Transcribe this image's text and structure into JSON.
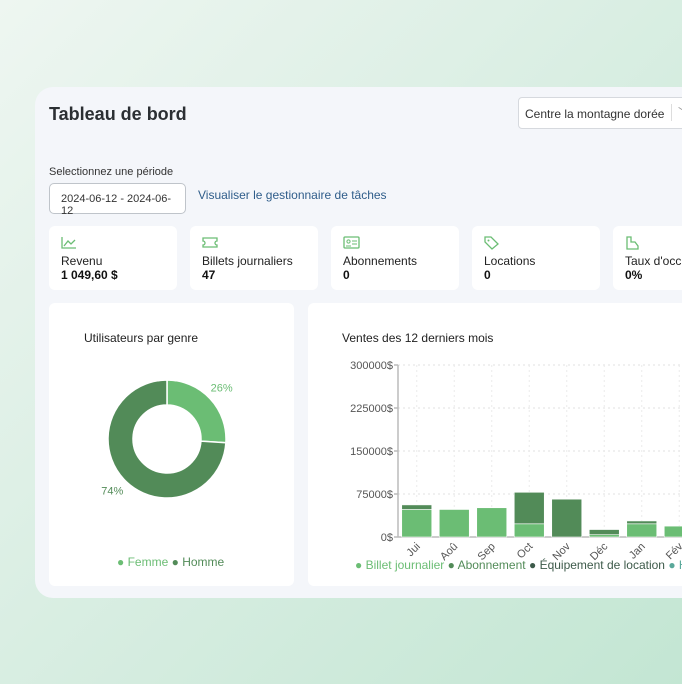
{
  "header": {
    "title": "Tableau de bord",
    "location_select": "Centre la montagne dorée"
  },
  "period": {
    "label": "Selectionnez une période",
    "value": "2024-06-12 - 2024-06-12",
    "task_link": "Visualiser le gestionnaire de tâches"
  },
  "kpis": [
    {
      "icon": "chart-line-icon",
      "label": "Revenu",
      "value": "1 049,60 $"
    },
    {
      "icon": "ticket-icon",
      "label": "Billets journaliers",
      "value": "47"
    },
    {
      "icon": "id-card-icon",
      "label": "Abonnements",
      "value": "0"
    },
    {
      "icon": "tag-icon",
      "label": "Locations",
      "value": "0"
    },
    {
      "icon": "building-icon",
      "label": "Taux d'occu",
      "value": "0%"
    }
  ],
  "colors": {
    "light_green": "#6bbd74",
    "dark_green": "#528b58",
    "equipment": "#3d5a4a",
    "teal": "#5aa89a"
  },
  "chart_data": [
    {
      "type": "pie",
      "title": "Utilisateurs par genre",
      "categories": [
        "Femme",
        "Homme"
      ],
      "values": [
        26,
        74
      ],
      "labels": [
        "26%",
        "74%"
      ],
      "colors": [
        "#6bbd74",
        "#528b58"
      ],
      "legend": "bottom"
    },
    {
      "type": "bar",
      "stacked": true,
      "title": "Ventes des 12 derniers mois",
      "categories": [
        "Jui",
        "Aoû",
        "Sep",
        "Oct",
        "Nov",
        "Déc",
        "Jan",
        "Fév"
      ],
      "yticks": [
        "0$",
        "75000$",
        "150000$",
        "225000$",
        "300000$"
      ],
      "ylim": [
        0,
        300000
      ],
      "grid": true,
      "legend": "bottom",
      "series": [
        {
          "name": "Billet journalier",
          "color": "#6bbd74",
          "values": [
            48000,
            48000,
            51000,
            23000,
            0,
            4000,
            23000,
            19000
          ]
        },
        {
          "name": "Abonnement",
          "color": "#528b58",
          "values": [
            8000,
            0,
            0,
            55000,
            66000,
            9000,
            5000,
            0
          ]
        },
        {
          "name": "Équipement de location",
          "color": "#3d5a4a",
          "values": [
            0,
            0,
            0,
            0,
            0,
            0,
            0,
            0
          ]
        },
        {
          "name": "H",
          "color": "#5aa89a",
          "values": [
            0,
            0,
            0,
            0,
            0,
            0,
            0,
            0
          ]
        }
      ]
    }
  ]
}
